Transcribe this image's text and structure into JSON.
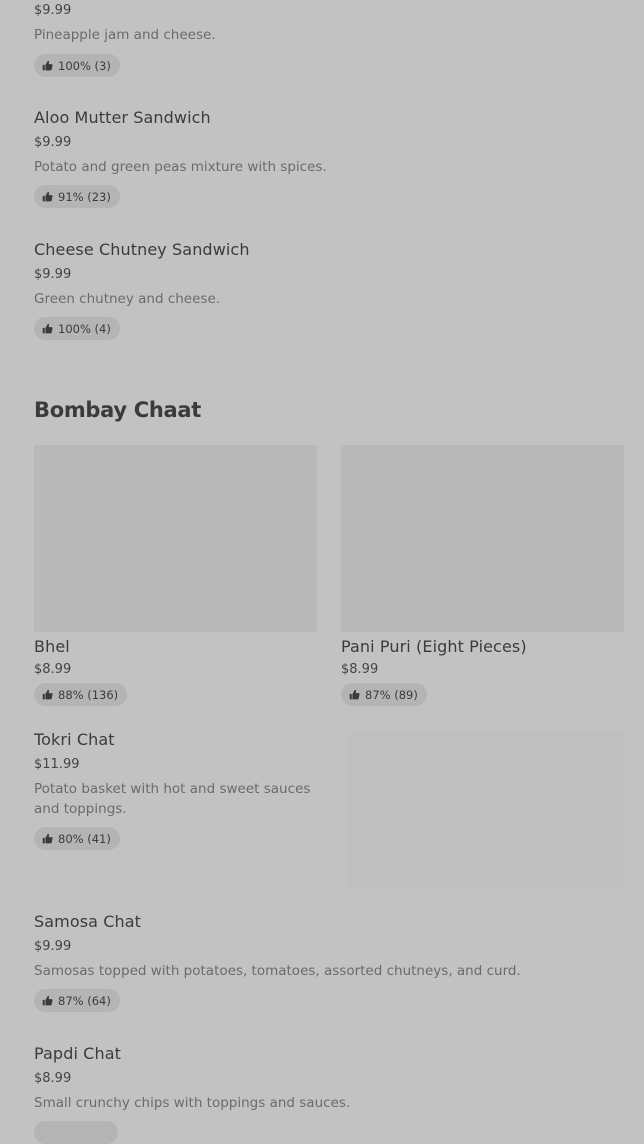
{
  "items_top": [
    {
      "price": "$9.99",
      "desc": "Pineapple jam and cheese.",
      "rating": "100% (3)"
    },
    {
      "name": "Aloo Mutter Sandwich",
      "price": "$9.99",
      "desc": "Potato and green peas mixture with spices.",
      "rating": "91% (23)"
    },
    {
      "name": "Cheese Chutney Sandwich",
      "price": "$9.99",
      "desc": "Green chutney and cheese.",
      "rating": "100% (4)"
    }
  ],
  "section": {
    "title": "Bombay Chaat"
  },
  "cards": [
    {
      "name": "Bhel",
      "price": "$8.99",
      "rating": "88% (136)"
    },
    {
      "name": "Pani Puri (Eight Pieces)",
      "price": "$8.99",
      "rating": "87% (89)"
    }
  ],
  "items_bottom": [
    {
      "name": "Tokri Chat",
      "price": "$11.99",
      "desc": "Potato basket with hot and sweet sauces and toppings.",
      "rating": "80% (41)"
    },
    {
      "name": "Samosa Chat",
      "price": "$9.99",
      "desc": "Samosas topped with potatoes, tomatoes, assorted chutneys, and curd.",
      "rating": "87% (64)"
    },
    {
      "name": "Papdi Chat",
      "price": "$8.99",
      "desc": "Small crunchy chips with toppings and sauces."
    }
  ],
  "icons": {
    "rating": "thumbs-up-icon"
  }
}
